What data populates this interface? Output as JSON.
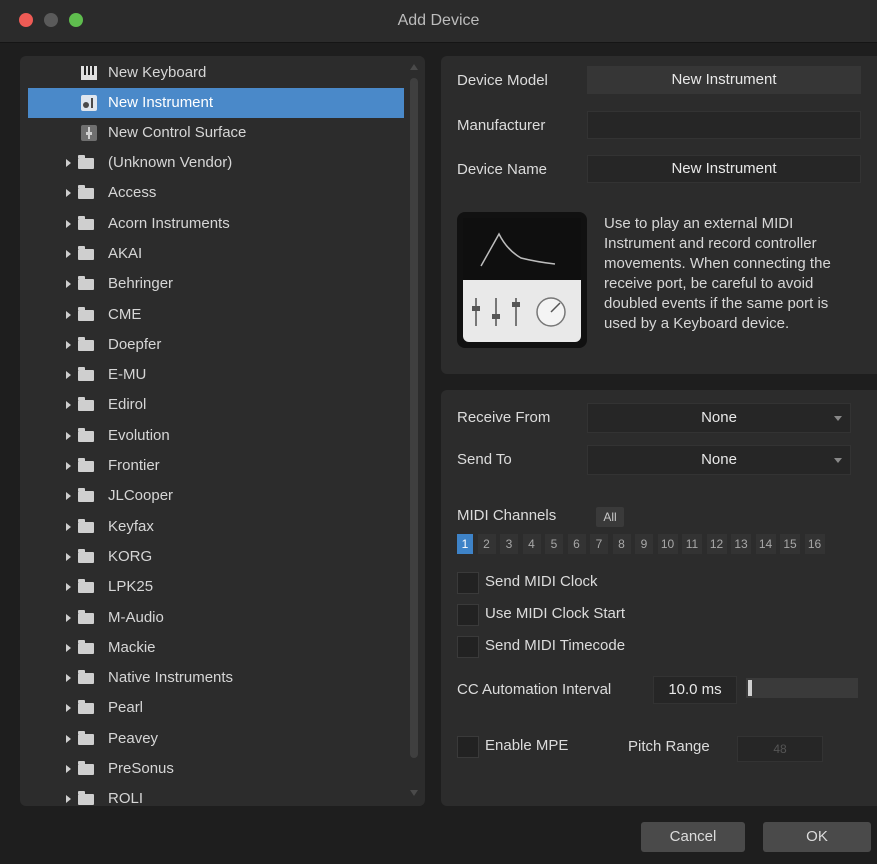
{
  "window": {
    "title": "Add Device"
  },
  "device_list": {
    "top_items": [
      {
        "label": "New Keyboard",
        "icon": "keyboard-icon"
      },
      {
        "label": "New Instrument",
        "icon": "instrument-icon",
        "selected": true
      },
      {
        "label": "New Control Surface",
        "icon": "control-surface-icon"
      }
    ],
    "vendors": [
      "(Unknown Vendor)",
      "Access",
      "Acorn Instruments",
      "AKAI",
      "Behringer",
      "CME",
      "Doepfer",
      "E-MU",
      "Edirol",
      "Evolution",
      "Frontier",
      "JLCooper",
      "Keyfax",
      "KORG",
      "LPK25",
      "M-Audio",
      "Mackie",
      "Native Instruments",
      "Pearl",
      "Peavey",
      "PreSonus",
      "ROLI"
    ]
  },
  "device_info": {
    "model_label": "Device Model",
    "model_value": "New Instrument",
    "manufacturer_label": "Manufacturer",
    "manufacturer_value": "",
    "name_label": "Device Name",
    "name_value": "New Instrument",
    "description": "Use to play an external MIDI Instrument and record controller movements. When connecting the receive port, be careful to avoid doubled events if the same port is used by a Keyboard device."
  },
  "midi": {
    "receive_label": "Receive From",
    "receive_value": "None",
    "send_label": "Send To",
    "send_value": "None",
    "channels_label": "MIDI Channels",
    "all_label": "All",
    "channels": [
      "1",
      "2",
      "3",
      "4",
      "5",
      "6",
      "7",
      "8",
      "9",
      "10",
      "11",
      "12",
      "13",
      "14",
      "15",
      "16"
    ],
    "active_channel": "1",
    "send_clock_label": "Send MIDI Clock",
    "use_clock_start_label": "Use MIDI Clock Start",
    "send_timecode_label": "Send MIDI Timecode",
    "cc_label": "CC Automation Interval",
    "cc_value": "10.0 ms",
    "mpe_label": "Enable MPE",
    "pitch_label": "Pitch Range",
    "pitch_value": "48"
  },
  "buttons": {
    "cancel": "Cancel",
    "ok": "OK"
  },
  "colors": {
    "selection": "#4a89c9",
    "active_channel": "#3e83c8",
    "close": "#ee5b55",
    "zoom": "#5fbd4e"
  }
}
